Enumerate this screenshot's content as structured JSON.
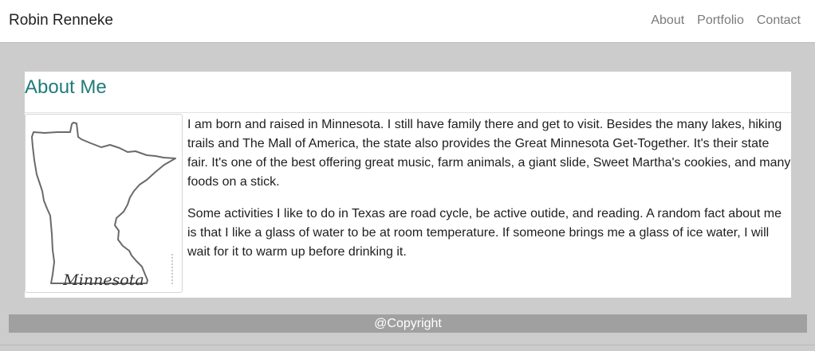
{
  "navbar": {
    "brand": "Robin Renneke",
    "links": [
      "About",
      "Portfolio",
      "Contact"
    ]
  },
  "about": {
    "title": "About Me",
    "image": {
      "label": "Minnesota",
      "icon": "minnesota-map-outline"
    },
    "paragraphs": [
      "I am born and raised in Minnesota. I still have family there and get to visit. Besides the many lakes, hiking trails and The Mall of America, the state also provides the Great Minnesota Get-Together. It's their state fair. It's one of the best offering great music, farm animals, a giant slide, Sweet Martha's cookies, and many foods on a stick.",
      "Some activities I like to do in Texas are road cycle, be active outide, and reading. A random fact about me is that I like a glass of water to be at room temperature. If someone brings me a glass of ice water, I will wait for it to warm up before drinking it."
    ]
  },
  "footer": {
    "text": "@Copyright"
  },
  "colors": {
    "page_bg": "#cccccc",
    "title": "#227a7a",
    "footer_bg": "#a0a0a0",
    "nav_link": "#7a7a7a"
  }
}
